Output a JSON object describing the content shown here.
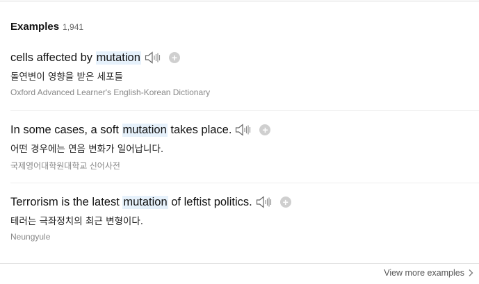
{
  "header": {
    "title": "Examples",
    "count": "1,941"
  },
  "examples": [
    {
      "before": "cells affected by ",
      "highlight": "mutation",
      "after": "",
      "korean": "돌연변이 영향을 받은 세포들",
      "source": "Oxford Advanced Learner's English-Korean Dictionary"
    },
    {
      "before": "In some cases, a soft ",
      "highlight": "mutation",
      "after": " takes place.",
      "korean": "어떤 경우에는 연음 변화가 일어납니다.",
      "source": "국제영어대학원대학교 신어사전"
    },
    {
      "before": "Terrorism is the latest ",
      "highlight": "mutation",
      "after": " of leftist politics.",
      "korean": "테러는 극좌정치의 최근 변형이다.",
      "source": "Neungyule"
    }
  ],
  "footer": {
    "more_label": "View more examples"
  },
  "icons": {
    "speaker": "speaker-icon",
    "add": "add-icon",
    "chevron": "chevron-right-icon"
  },
  "colors": {
    "highlight": "#e6f1fb",
    "source_text": "#888888",
    "add_button": "#cfcfcf"
  }
}
